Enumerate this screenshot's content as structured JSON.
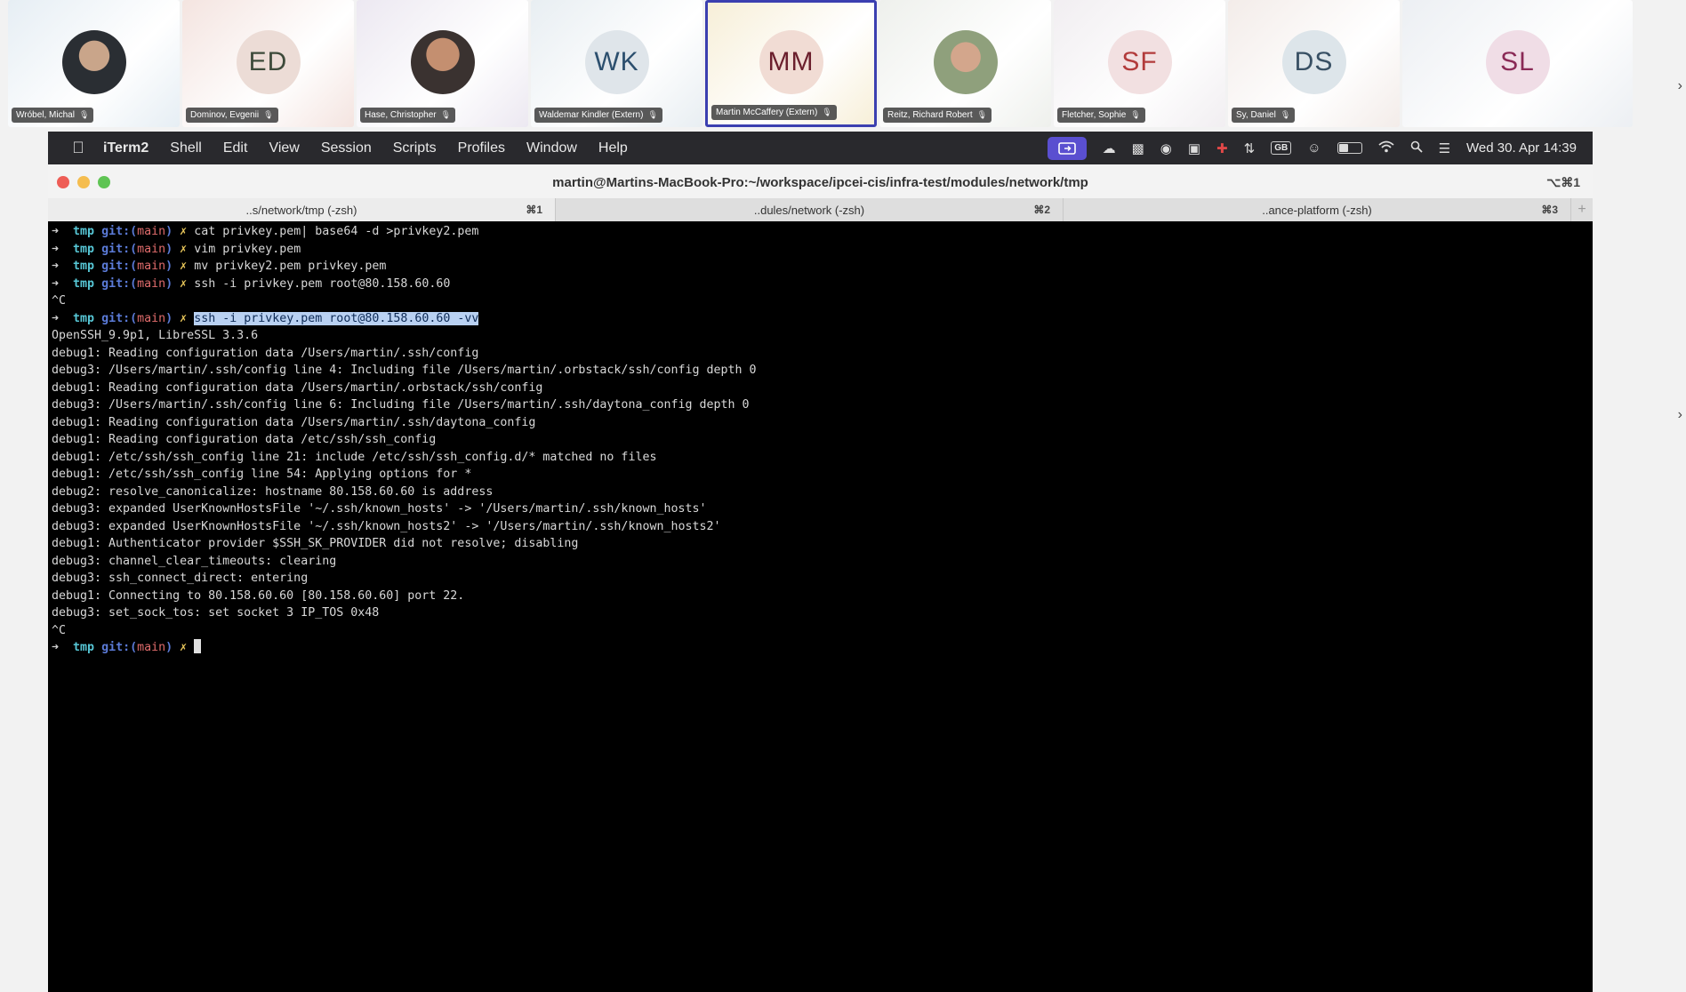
{
  "participants": [
    {
      "initials": "",
      "name": "Wróbel, Michal",
      "photo": true,
      "bg": "#e6eef4"
    },
    {
      "initials": "ED",
      "name": "Dominov, Evgenii",
      "photo": false,
      "bg": "#f4e4e0",
      "avatar_color": "#ecdcd6",
      "text_color": "#3d4a3a"
    },
    {
      "initials": "",
      "name": "Hase, Christopher",
      "photo": true,
      "bg": "#ece8f1"
    },
    {
      "initials": "WK",
      "name": "Waldemar Kindler (Extern)",
      "photo": false,
      "bg": "#e8eef2",
      "avatar_color": "#dfe5ea",
      "text_color": "#2c4f6e"
    },
    {
      "initials": "MM",
      "name": "Martin McCaffery (Extern)",
      "photo": false,
      "bg": "#f7efd8",
      "avatar_color": "#f1dcd4",
      "text_color": "#6b1f2d",
      "active": true
    },
    {
      "initials": "",
      "name": "Reitz, Richard Robert",
      "photo": true,
      "bg": "#eef0ec"
    },
    {
      "initials": "SF",
      "name": "Fletcher, Sophie",
      "photo": false,
      "bg": "#f1eef1",
      "avatar_color": "#f2e0e1",
      "text_color": "#b23b3b"
    },
    {
      "initials": "DS",
      "name": "Sy, Daniel",
      "photo": false,
      "bg": "#f3ece9",
      "avatar_color": "#dde5ea",
      "text_color": "#385064"
    },
    {
      "initials": "SL",
      "name": "",
      "photo": false,
      "bg": "#eceff3",
      "avatar_color": "#f0dde6",
      "text_color": "#8a2a56"
    }
  ],
  "menubar": {
    "app": "iTerm2",
    "items": [
      "Shell",
      "Edit",
      "View",
      "Session",
      "Scripts",
      "Profiles",
      "Window",
      "Help"
    ],
    "datetime": "Wed 30. Apr  14:39",
    "keyboard": "GB"
  },
  "window": {
    "title": "martin@Martins-MacBook-Pro:~/workspace/ipcei-cis/infra-test/modules/network/tmp",
    "shortcut": "⌥⌘1",
    "tabs": [
      {
        "label": "..s/network/tmp (-zsh)",
        "kbd": "⌘1"
      },
      {
        "label": "..dules/network (-zsh)",
        "kbd": "⌘2"
      },
      {
        "label": "..ance-platform (-zsh)",
        "kbd": "⌘3"
      }
    ],
    "plus": "+"
  },
  "prompt": {
    "arrow": "➜",
    "dir": "tmp",
    "git": "git:(",
    "branch": "main",
    "git_close": ")",
    "x": "✗"
  },
  "terminal": {
    "commands": [
      "cat privkey.pem| base64 -d >privkey2.pem",
      "vim privkey.pem",
      "mv privkey2.pem privkey.pem",
      "ssh -i privkey.pem root@80.158.60.60"
    ],
    "interrupt": "^C",
    "highlighted_command": "ssh -i privkey.pem root@80.158.60.60 -vv",
    "output": [
      "OpenSSH_9.9p1, LibreSSL 3.3.6",
      "debug1: Reading configuration data /Users/martin/.ssh/config",
      "debug3: /Users/martin/.ssh/config line 4: Including file /Users/martin/.orbstack/ssh/config depth 0",
      "debug1: Reading configuration data /Users/martin/.orbstack/ssh/config",
      "debug3: /Users/martin/.ssh/config line 6: Including file /Users/martin/.ssh/daytona_config depth 0",
      "debug1: Reading configuration data /Users/martin/.ssh/daytona_config",
      "debug1: Reading configuration data /etc/ssh/ssh_config",
      "debug1: /etc/ssh/ssh_config line 21: include /etc/ssh/ssh_config.d/* matched no files",
      "debug1: /etc/ssh/ssh_config line 54: Applying options for *",
      "debug2: resolve_canonicalize: hostname 80.158.60.60 is address",
      "debug3: expanded UserKnownHostsFile '~/.ssh/known_hosts' -> '/Users/martin/.ssh/known_hosts'",
      "debug3: expanded UserKnownHostsFile '~/.ssh/known_hosts2' -> '/Users/martin/.ssh/known_hosts2'",
      "debug1: Authenticator provider $SSH_SK_PROVIDER did not resolve; disabling",
      "debug3: channel_clear_timeouts: clearing",
      "debug3: ssh_connect_direct: entering",
      "debug1: Connecting to 80.158.60.60 [80.158.60.60] port 22.",
      "debug3: set_sock_tos: set socket 3 IP_TOS 0x48"
    ],
    "interrupt2": "^C"
  },
  "colors": {
    "accent": "#3b3fb0",
    "menubar": "#29292d",
    "terminal_bg": "#000000"
  }
}
